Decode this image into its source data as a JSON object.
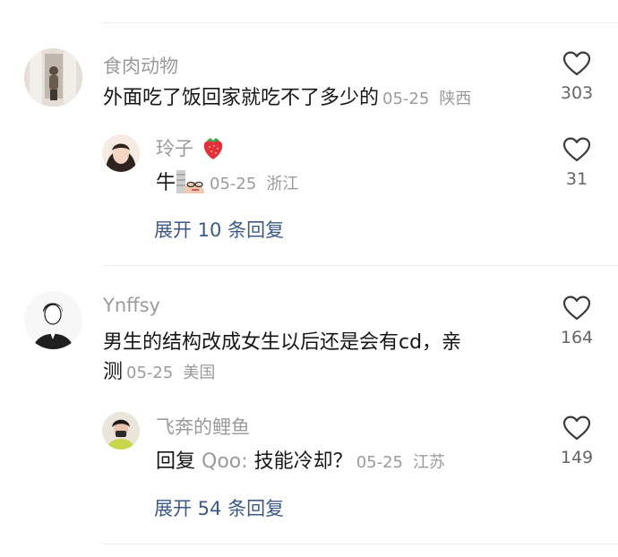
{
  "comments": [
    {
      "user": "食肉动物",
      "text": "外面吃了饭回家就吃不了多少的",
      "date": "05-25",
      "location": "陕西",
      "likes": "303",
      "reply": {
        "user": "玲子",
        "user_emoji": "strawberry-icon",
        "text": "牛",
        "text_emoji": "doge-emoji-icon",
        "date": "05-25",
        "location": "浙江",
        "likes": "31"
      },
      "expand_label": "展开 10 条回复"
    },
    {
      "user": "Ynffsy",
      "text": "男生的结构改成女生以后还是会有cd，亲",
      "text_line2": "测",
      "date": "05-25",
      "location": "美国",
      "likes": "164",
      "reply": {
        "user": "飞奔的鲤鱼",
        "text_prefix": "回复",
        "mention": "Qoo:",
        "text": "技能冷却？",
        "date": "05-25",
        "location": "江苏",
        "likes": "149"
      },
      "expand_label": "展开 54 条回复"
    }
  ],
  "colors": {
    "username": "#9b9b9b",
    "text": "#161616",
    "expand_link": "#3d5a86",
    "divider": "#ececec"
  }
}
